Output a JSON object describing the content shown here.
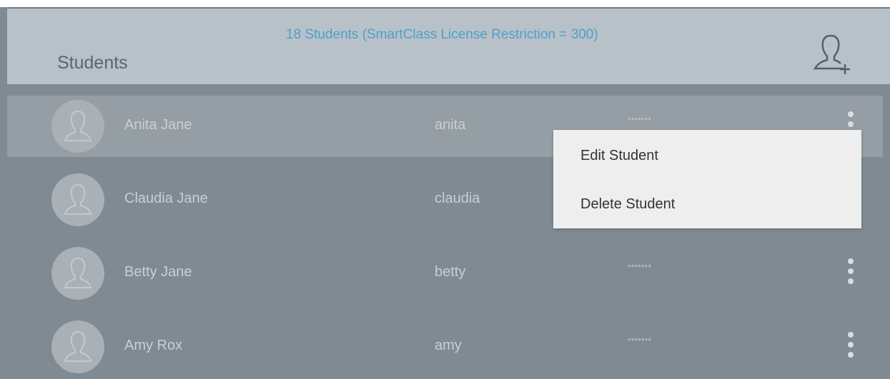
{
  "header": {
    "title": "Students",
    "count_text": "18 Students (SmartClass License Restriction = 300)",
    "add_icon": "add-user-icon"
  },
  "students": [
    {
      "name": "Anita Jane",
      "username": "anita",
      "password": "*******"
    },
    {
      "name": "Claudia Jane",
      "username": "claudia",
      "password": "*******"
    },
    {
      "name": "Betty Jane",
      "username": "betty",
      "password": "*******"
    },
    {
      "name": "Amy Rox",
      "username": "amy",
      "password": "*******"
    }
  ],
  "context_menu": {
    "edit_label": "Edit Student",
    "delete_label": "Delete Student"
  },
  "colors": {
    "header_bg": "#b8c1c7",
    "list_bg": "#808a92",
    "selected_row": "#959ea5",
    "accent": "#4ea0cc"
  }
}
